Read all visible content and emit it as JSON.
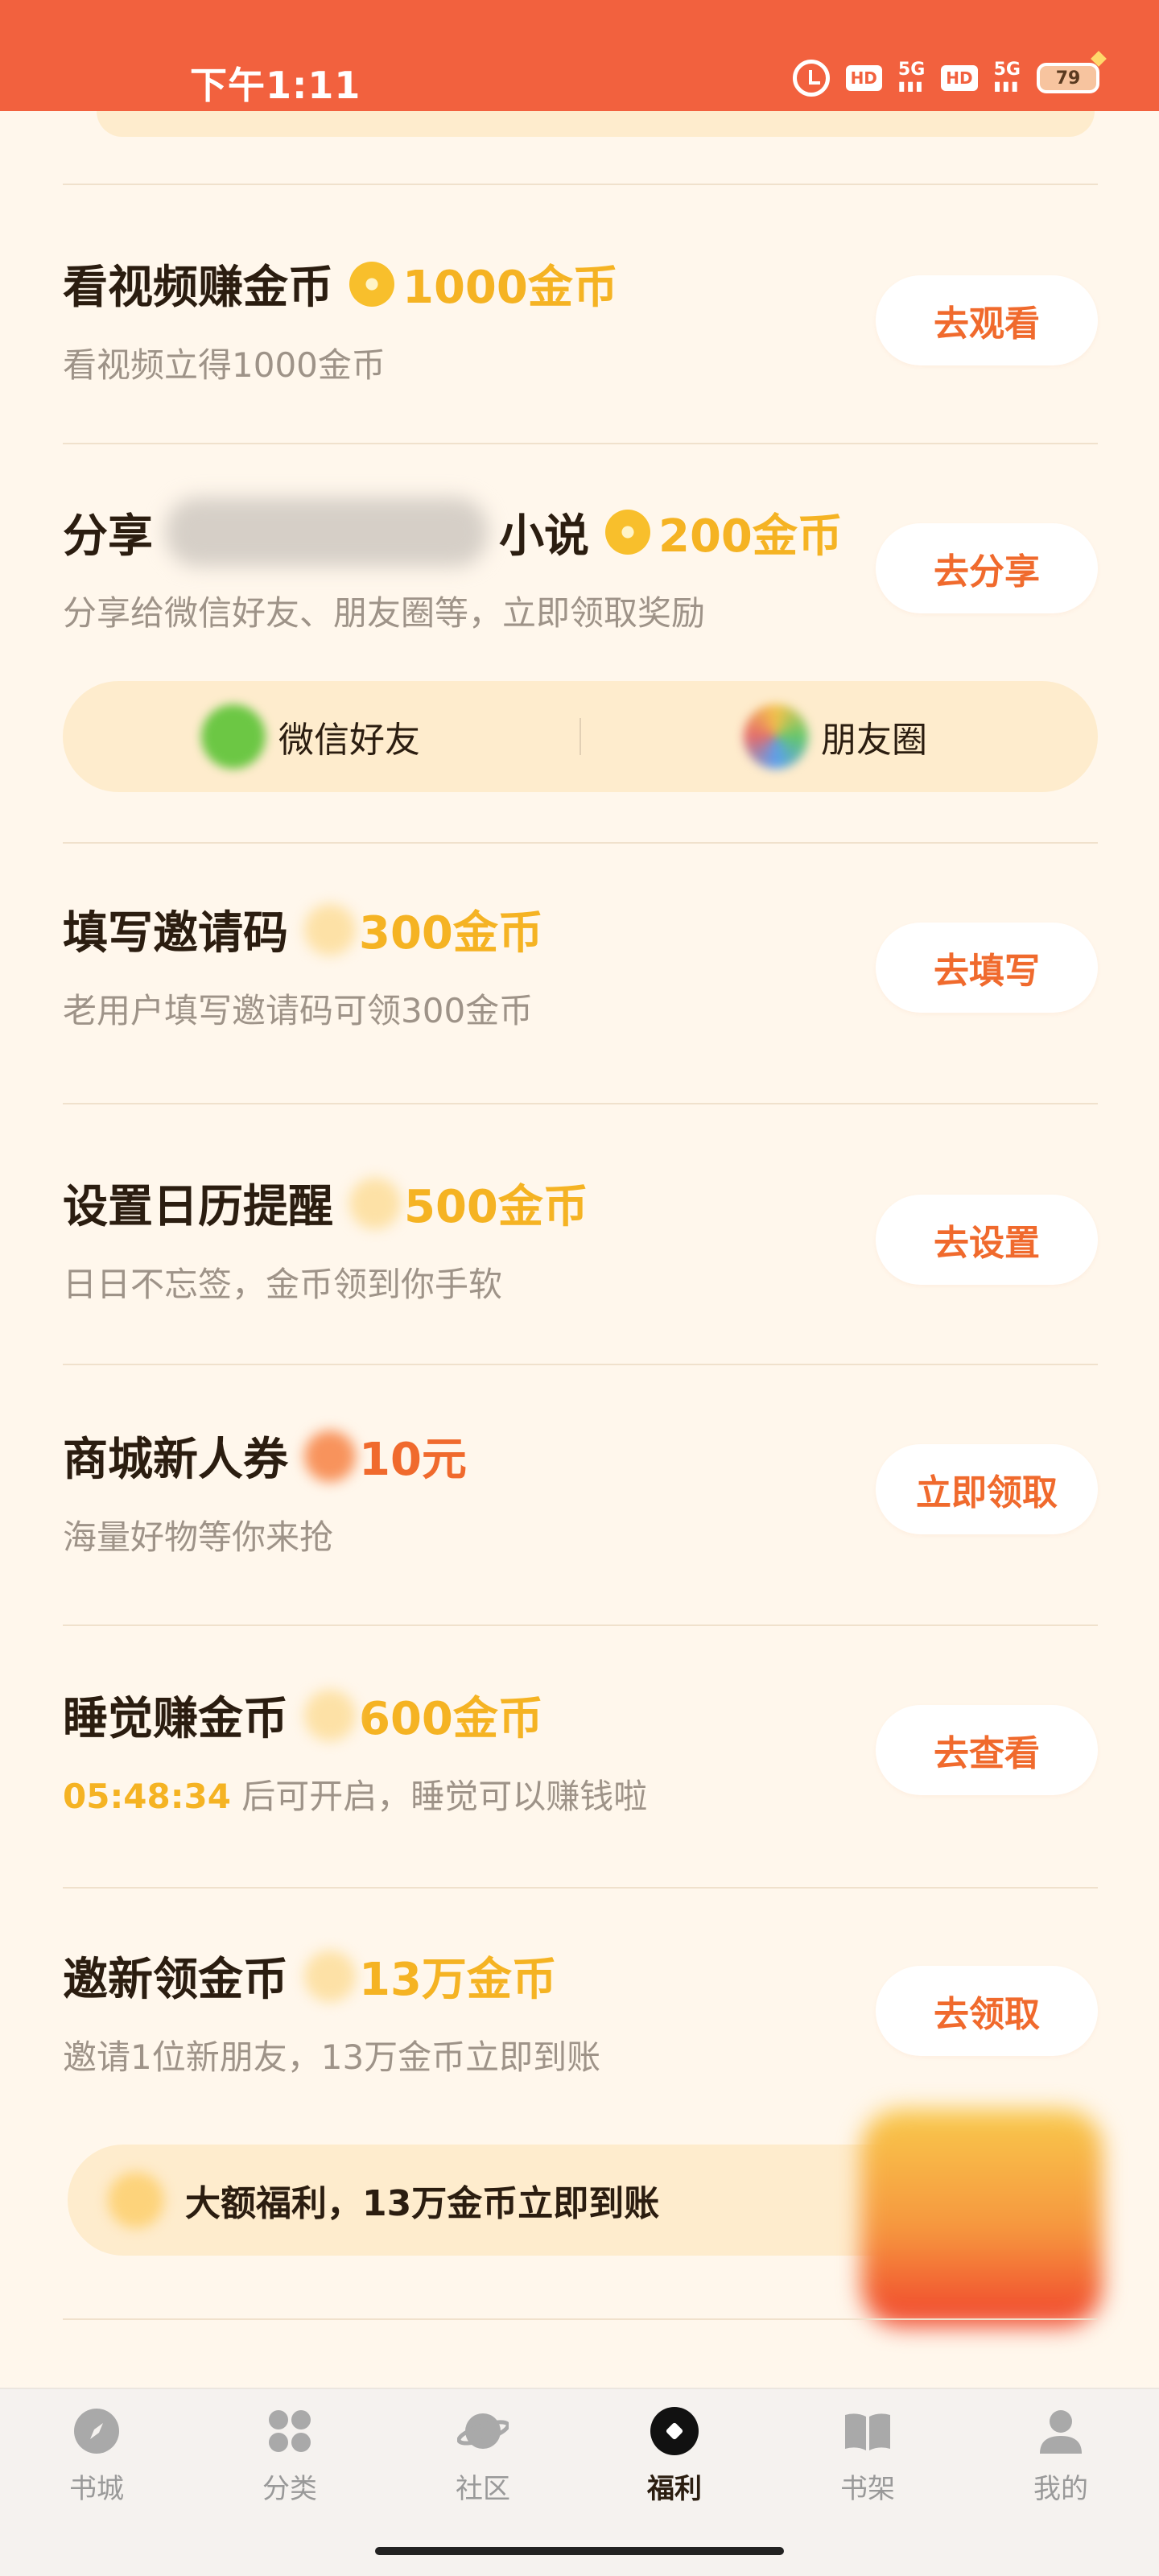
{
  "status_bar": {
    "time": "下午1:11",
    "hd1": "HD",
    "signal1": "5G",
    "hd2": "HD",
    "signal2": "5G",
    "battery": "79"
  },
  "tasks": [
    {
      "title": "看视频赚金币",
      "reward": "1000金币",
      "subtitle": "看视频立得1000金币",
      "button": "去观看"
    },
    {
      "title_prefix": "分享",
      "title_suffix": "小说",
      "reward": "200金币",
      "subtitle": "分享给微信好友、朋友圈等，立即领取奖励",
      "button": "去分享"
    },
    {
      "title": "填写邀请码",
      "reward": "300金币",
      "subtitle": "老用户填写邀请码可领300金币",
      "button": "去填写"
    },
    {
      "title": "设置日历提醒",
      "reward": "500金币",
      "subtitle": "日日不忘签，金币领到你手软",
      "button": "去设置"
    },
    {
      "title": "商城新人券",
      "reward": "10元",
      "subtitle": "海量好物等你来抢",
      "button": "立即领取"
    },
    {
      "title": "睡觉赚金币",
      "reward": "600金币",
      "countdown": "05:48:34",
      "subtitle": "后可开启，睡觉可以赚钱啦",
      "button": "去查看"
    },
    {
      "title": "邀新领金币",
      "reward": "13万金币",
      "subtitle": "邀请1位新朋友，13万金币立即到账",
      "button": "去领取"
    }
  ],
  "share_options": {
    "wechat": "微信好友",
    "moments": "朋友圈"
  },
  "bonus_banner": "大额福利，13万金币立即到账",
  "bottom_nav": [
    {
      "label": "书城",
      "icon": "compass-icon"
    },
    {
      "label": "分类",
      "icon": "grid-icon"
    },
    {
      "label": "社区",
      "icon": "planet-icon"
    },
    {
      "label": "福利",
      "icon": "gift-icon",
      "active": true
    },
    {
      "label": "书架",
      "icon": "book-icon"
    },
    {
      "label": "我的",
      "icon": "user-icon"
    }
  ]
}
